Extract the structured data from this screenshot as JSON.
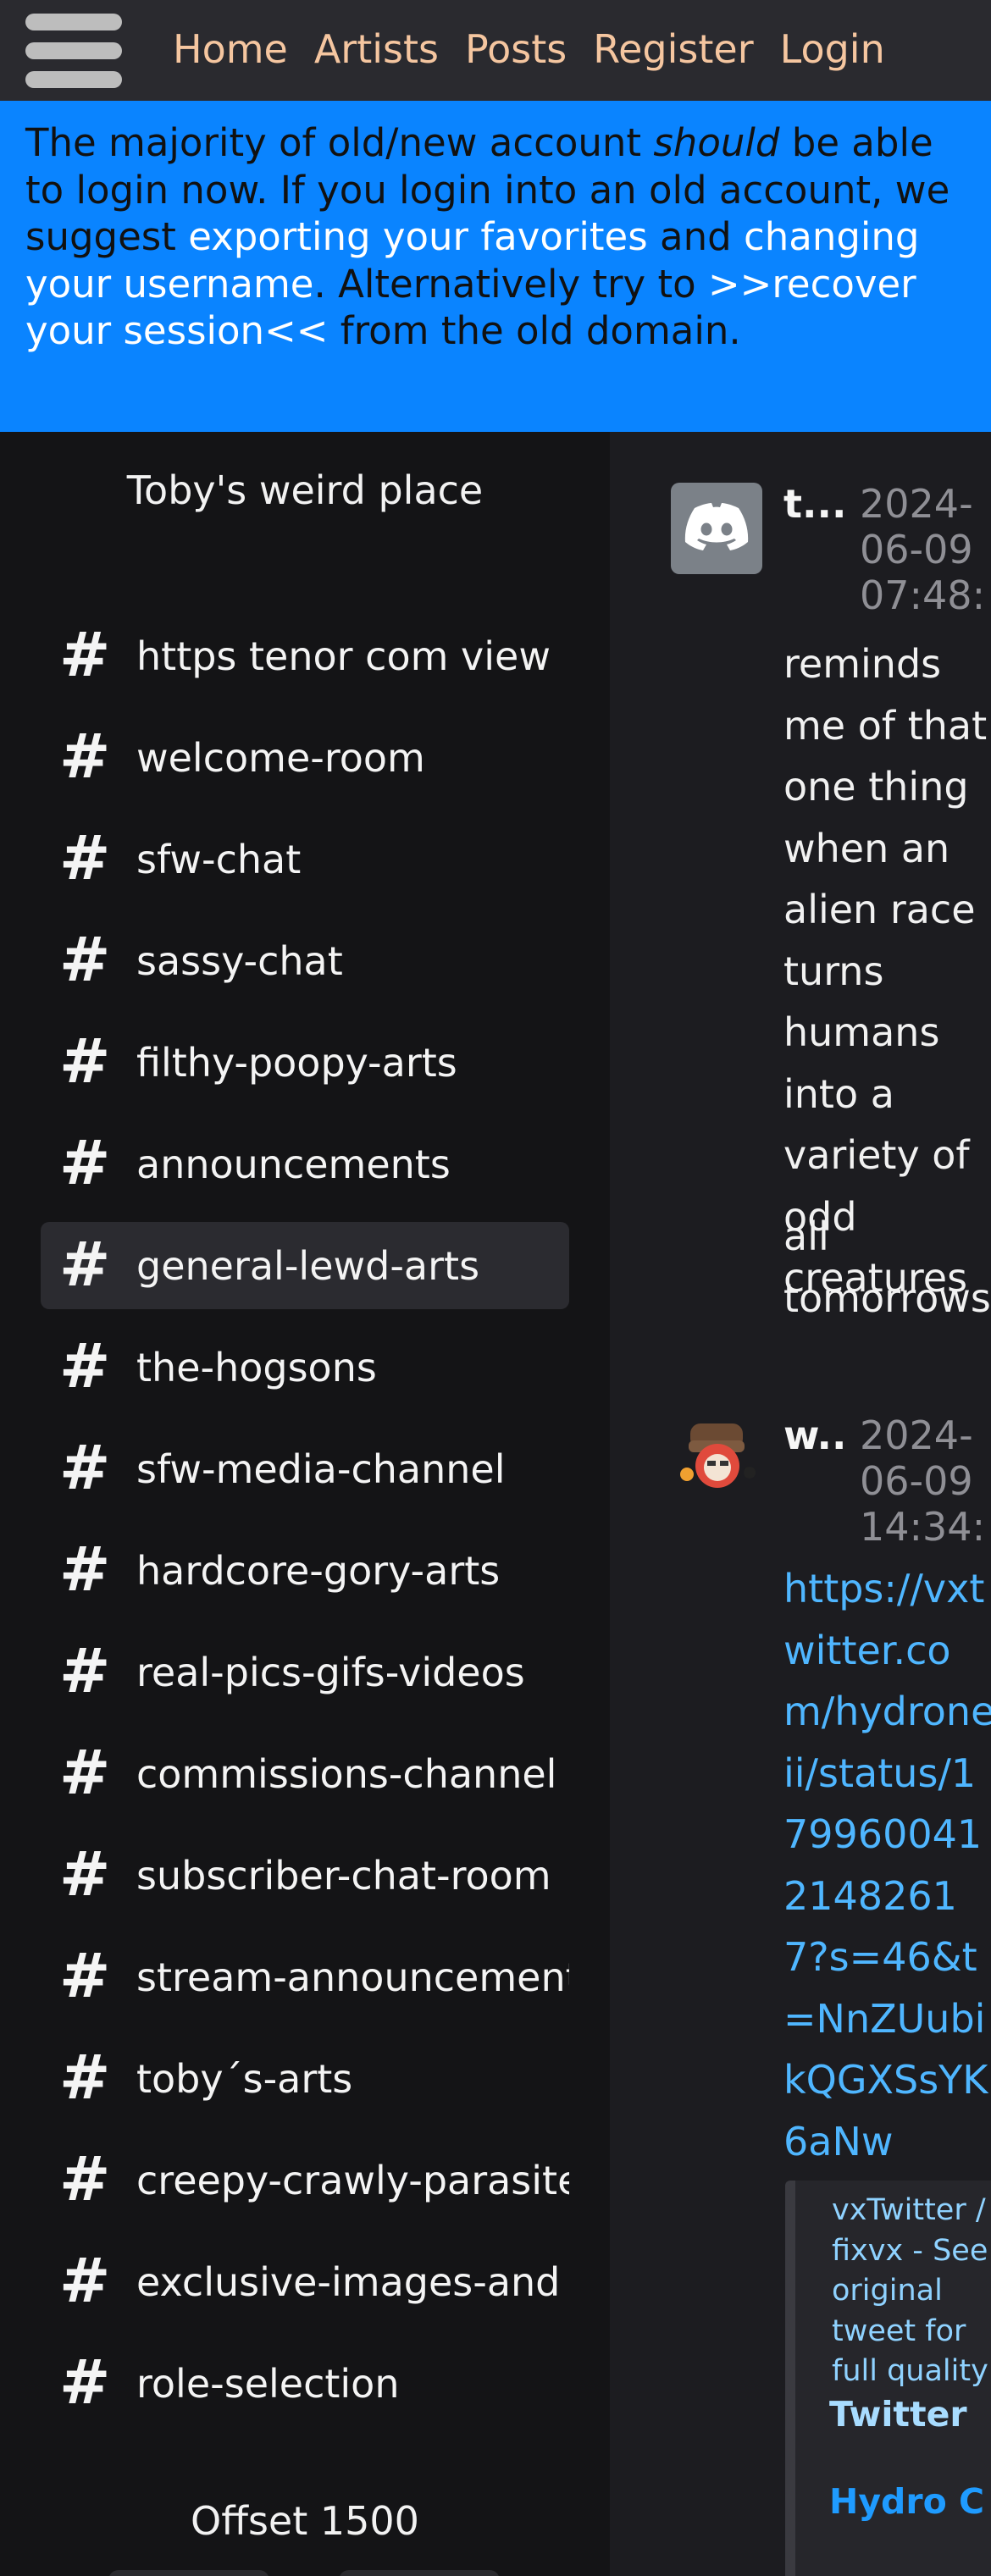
{
  "nav": {
    "links": [
      "Home",
      "Artists",
      "Posts",
      "Register",
      "Login"
    ]
  },
  "banner": {
    "part1": "The majority of old/new account ",
    "emphasis": "should",
    "part2": " be able to login now. If you login into an old account, we suggest ",
    "link1": "exporting your favorites",
    "and": " and ",
    "link2": "changing your username",
    "part3": ". Alternatively try to ",
    "link3": ">>recover your session<<",
    "part4": " from the old domain."
  },
  "sidebar": {
    "server_name": "Toby's weird place",
    "channels": [
      "https tenor com view",
      "welcome-room",
      "sfw-chat",
      "sassy-chat",
      "filthy-poopy-arts",
      "announcements",
      "general-lewd-arts",
      "the-hogsons",
      "sfw-media-channel",
      "hardcore-gory-arts",
      "real-pics-gifs-videos",
      "commissions-channel",
      "subscriber-chat-room",
      "stream-announcements",
      "toby´s-arts",
      "creepy-crawly-parasites",
      "exclusive-images-and",
      "role-selection"
    ],
    "active_channel": "general-lewd-arts",
    "offset_label": "Offset 1500"
  },
  "messages": [
    {
      "author": "t...",
      "timestamp": "2024-06-09 07:48:",
      "paragraphs": [
        "reminds me of that one thing when an alien race turns humans into a variety of odd creatures",
        "all tomorrows"
      ]
    },
    {
      "author": "w..",
      "timestamp": "2024-06-09 14:34:",
      "link": "https://vxtwitter.com/hydroneii/status/17996004121482617?s=46&t=NnZUubikQGXSsYK6aNw",
      "embed": {
        "description": "vxTwitter / fixvx - See original tweet for full quality",
        "provider": "Twitter",
        "title": "Hydro C"
      }
    }
  ],
  "colors": {
    "banner_bg": "#0a84ff",
    "nav_link": "#f5c6a0",
    "link": "#4fb6ff",
    "sidebar_bg": "#141416",
    "active_channel_bg": "#2b2b30"
  }
}
